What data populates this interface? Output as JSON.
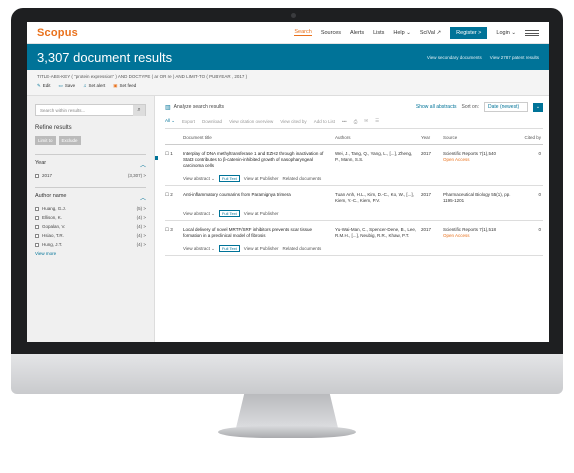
{
  "topbar": {
    "logo": "Scopus",
    "nav": [
      "Search",
      "Sources",
      "Alerts",
      "Lists",
      "Help ⌄",
      "SciVal ↗"
    ],
    "register": "Register >",
    "login": "Login ⌄"
  },
  "banner": {
    "title": "3,307 document results",
    "link_secondary": "View secondary documents",
    "link_patents": "View 2787 patent results"
  },
  "query": {
    "text": "TITLE-ABS-KEY ( \"protein expression\" ) AND DOCTYPE ( ar OR re ) AND LIMIT-TO ( PUBYEAR , 2017 )",
    "actions": [
      "Edit",
      "Save",
      "Set alert",
      "Set feed"
    ]
  },
  "sidebar": {
    "search_placeholder": "Search within results...",
    "refine_title": "Refine results",
    "limit_to": "Limit to",
    "exclude": "Exclude",
    "year_facet": {
      "title": "Year",
      "rows": [
        {
          "label": "2017",
          "count": "(3,307) >"
        }
      ]
    },
    "author_facet": {
      "title": "Author name",
      "rows": [
        {
          "label": "Huang, G.J.",
          "count": "(5) >"
        },
        {
          "label": "Ellison, K.",
          "count": "(4) >"
        },
        {
          "label": "Gopalan, V.",
          "count": "(4) >"
        },
        {
          "label": "Hsiao, T.R.",
          "count": "(4) >"
        },
        {
          "label": "Hung, J.T.",
          "count": "(4) >"
        }
      ],
      "view_more": "View more"
    }
  },
  "main": {
    "analyze": "Analyze search results",
    "show_abstracts": "Show all abstracts",
    "sort_label": "Sort on:",
    "sort_value": "Date (newest)",
    "toolbar": [
      "All ⌄",
      "Export",
      "Download",
      "View citation overview",
      "View cited by",
      "Add to List",
      "•••"
    ],
    "columns": {
      "title": "Document title",
      "authors": "Authors",
      "year": "Year",
      "source": "Source",
      "cited": "Cited by"
    },
    "rows": [
      {
        "num": "1",
        "title": "Interplay of DNA methyltransferase 1 and EZH2 through inactivation of Stat3 contributes to β-catenin-inhibited growth of nasopharyngeal carcinoma cells",
        "authors": "Wei, J., Tang, Q., Yang, L., [...], Zheng, P., Mann, S.S.",
        "year": "2017",
        "source": "Scientific Reports 7(1),540",
        "open_access": "Open Access",
        "cited": "0"
      },
      {
        "num": "2",
        "title": "Anti-inflammatory coumarins from Paramignya trimera",
        "authors": "Tuan Anh, H.L., Kim, D.-C., Ko, W., [...], Kiem, Y.-C., Kiem, P.V.",
        "year": "2017",
        "source": "Pharmaceutical Biology 55(1), pp. 1195-1201",
        "open_access": "",
        "cited": "0"
      },
      {
        "num": "3",
        "title": "Local delivery of novel MRTF/SRF inhibitors prevents scar tissue formation in a preclinical model of fibrosis",
        "authors": "Yu-Wai-Man, C., Spencer-Dene, B., Lee, R.M.H., [...], Neubig, R.R., Khaw, P.T.",
        "year": "2017",
        "source": "Scientific Reports 7(1),518",
        "open_access": "Open Access",
        "cited": "0"
      }
    ],
    "view_abstract": "View abstract ⌄",
    "full_text": "Full Text",
    "view_publisher": "View at Publisher",
    "related": "Related documents"
  }
}
